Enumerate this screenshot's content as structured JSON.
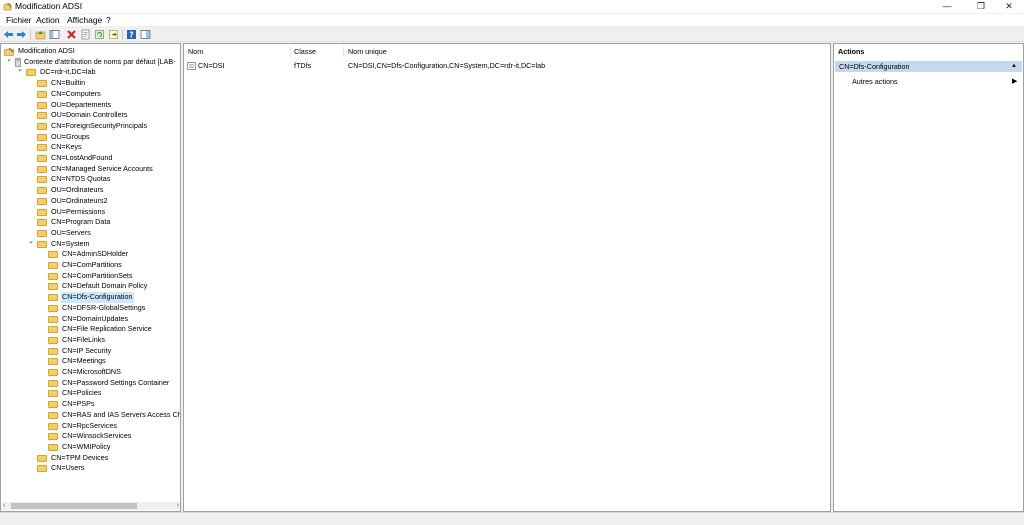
{
  "window": {
    "title": "Modification ADSI",
    "minimize": "—",
    "maximize": "❐",
    "close": "✕"
  },
  "menu": [
    "Fichier",
    "Action",
    "Affichage",
    "?"
  ],
  "toolbar": {
    "icons": [
      "back-icon",
      "forward-icon",
      "up-folder-icon",
      "console-tree-icon",
      "delete-icon",
      "properties-icon",
      "refresh-icon",
      "export-icon",
      "help-icon",
      "show-hide-icon"
    ]
  },
  "tree": {
    "root": "Modification ADSI",
    "context": "Contexte d'attribution de noms par défaut [LAB-",
    "domain": "DC=rdr-it,DC=lab",
    "domain_children": [
      "CN=Builtin",
      "CN=Computers",
      "OU=Departements",
      "OU=Domain Controllers",
      "CN=ForeignSecurityPrincipals",
      "OU=Groups",
      "CN=Keys",
      "CN=LostAndFound",
      "CN=Managed Service Accounts",
      "CN=NTDS Quotas",
      "OU=Ordinateurs",
      "OU=Ordinateurs2",
      "OU=Permissions",
      "CN=Program Data",
      "OU=Servers",
      "CN=System"
    ],
    "system_children": [
      "CN=AdminSDHolder",
      "CN=ComPartitions",
      "CN=ComPartitionSets",
      "CN=Default Domain Policy",
      "CN=Dfs-Configuration",
      "CN=DFSR-GlobalSettings",
      "CN=DomainUpdates",
      "CN=File Replication Service",
      "CN=FileLinks",
      "CN=IP Security",
      "CN=Meetings",
      "CN=MicrosoftDNS",
      "CN=Password Settings Container",
      "CN=Policies",
      "CN=PSPs",
      "CN=RAS and IAS Servers Access Chec",
      "CN=RpcServices",
      "CN=WinsockServices",
      "CN=WMIPolicy"
    ],
    "after_system": [
      "CN=TPM Devices",
      "CN=Users"
    ],
    "selected": "CN=Dfs-Configuration"
  },
  "list": {
    "columns": [
      "Nom",
      "Classe",
      "Nom unique"
    ],
    "rows": [
      {
        "nom": "CN=DSI",
        "classe": "fTDfs",
        "nom_unique": "CN=DSI,CN=Dfs-Configuration,CN=System,DC=rdr-it,DC=lab"
      }
    ]
  },
  "actions": {
    "title": "Actions",
    "section": "CN=Dfs-Configuration",
    "items": [
      "Autres actions"
    ]
  },
  "colors": {
    "selection": "#cce8ff",
    "actions_header": "#c4d9ee",
    "folder": "#f4ce6b"
  }
}
